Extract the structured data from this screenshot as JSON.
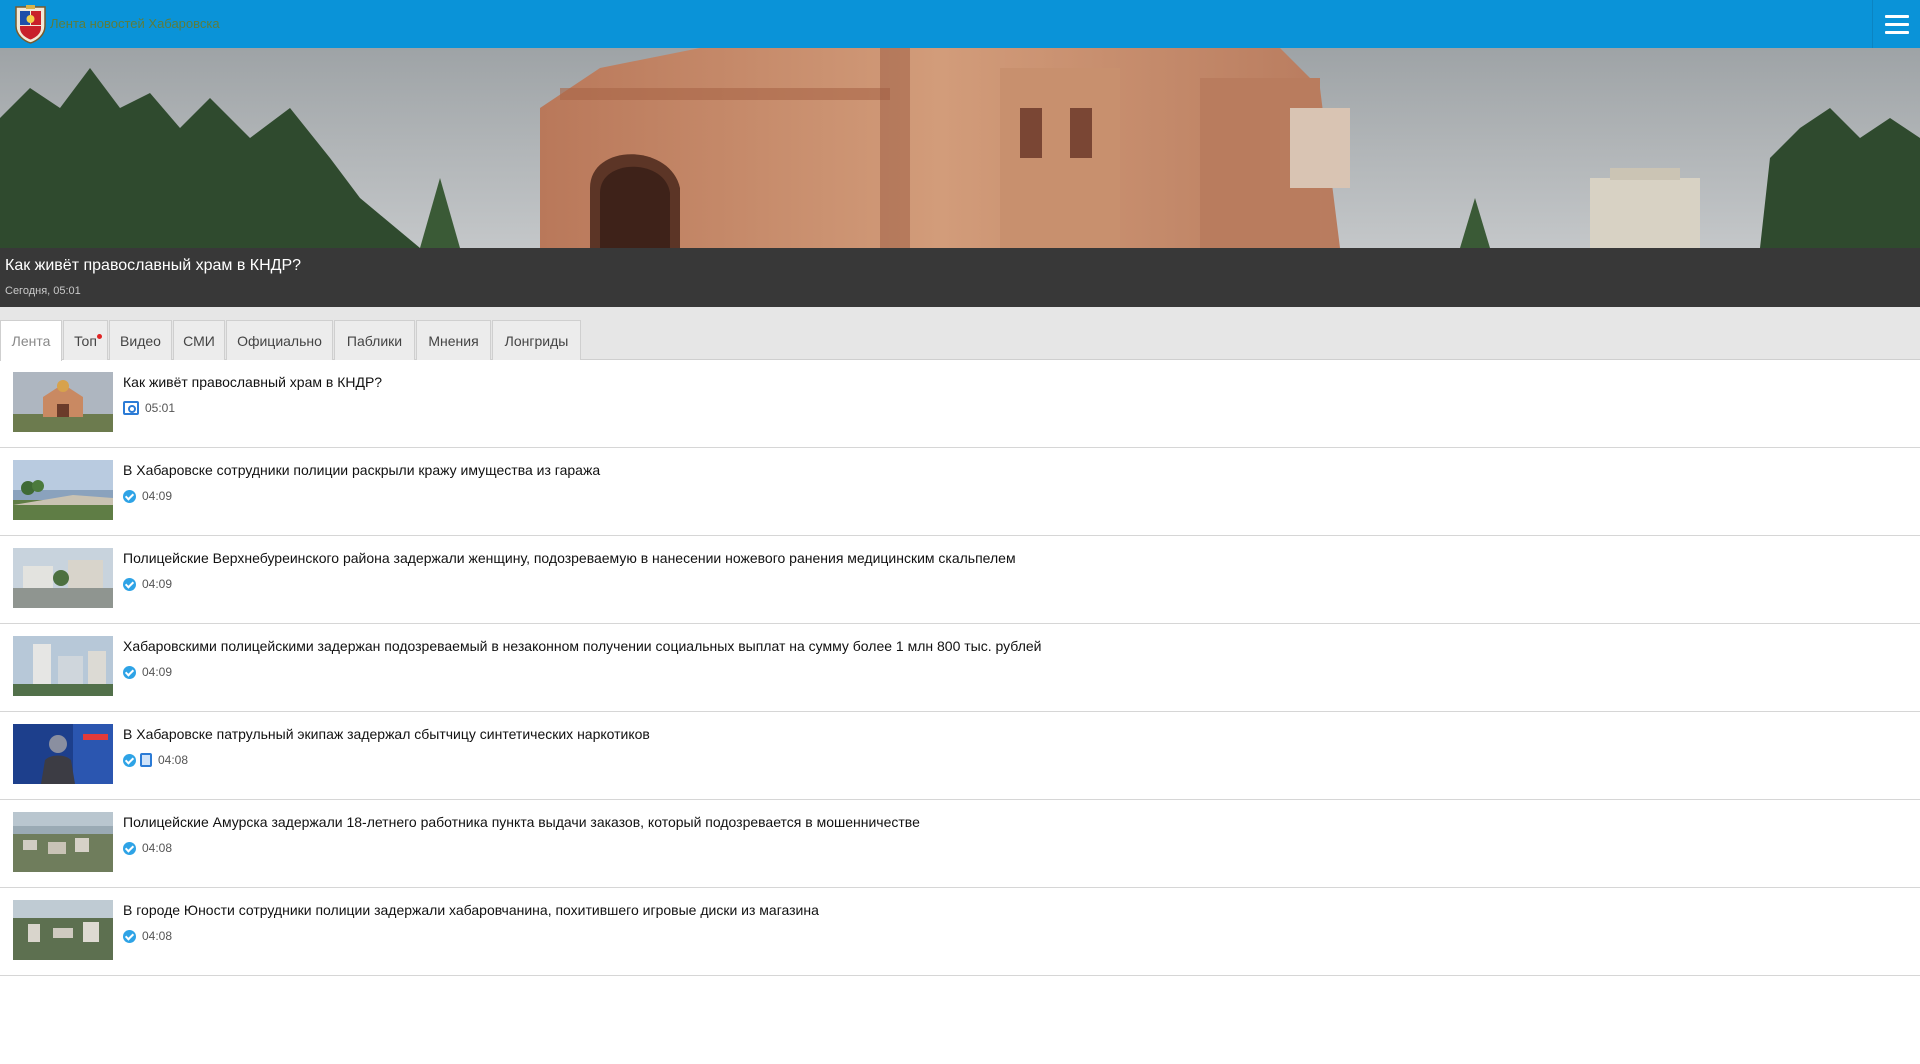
{
  "header": {
    "site_title": "Лента новостей Хабаровска",
    "menu_icon": "hamburger-menu-icon",
    "accent_color": "#0a93d8"
  },
  "hero": {
    "title": "Как живёт православный храм в КНДР?",
    "date": "Сегодня, 05:01"
  },
  "tabs": [
    {
      "label": "Лента",
      "active": true
    },
    {
      "label": "Топ",
      "active": false,
      "badge": "red-dot"
    },
    {
      "label": "Видео",
      "active": false
    },
    {
      "label": "СМИ",
      "active": false
    },
    {
      "label": "Официально",
      "active": false
    },
    {
      "label": "Паблики",
      "active": false
    },
    {
      "label": "Мнения",
      "active": false
    },
    {
      "label": "Лонгриды",
      "active": false
    }
  ],
  "news": [
    {
      "title": "Как живёт православный храм в КНДР?",
      "time": "05:01",
      "icons": [
        "camera-icon"
      ]
    },
    {
      "title": "В Хабаровске сотрудники полиции раскрыли кражу имущества из гаража",
      "time": "04:09",
      "icons": [
        "verified-check-icon"
      ]
    },
    {
      "title": "Полицейские Верхнебуреинского района задержали женщину, подозреваемую в нанесении ножевого ранения медицинским скальпелем",
      "time": "04:09",
      "icons": [
        "verified-check-icon"
      ]
    },
    {
      "title": "Хабаровскими полицейскими задержан подозреваемый в незаконном получении социальных выплат на сумму более 1 млн 800 тыс. рублей",
      "time": "04:09",
      "icons": [
        "verified-check-icon"
      ]
    },
    {
      "title": "В Хабаровске патрульный экипаж задержал сбытчицу синтетических наркотиков",
      "time": "04:08",
      "icons": [
        "verified-check-icon",
        "document-icon"
      ]
    },
    {
      "title": "Полицейские Амурска задержали 18-летнего работника пункта выдачи заказов, который подозревается в мошенничестве",
      "time": "04:08",
      "icons": [
        "verified-check-icon"
      ]
    },
    {
      "title": "В городе Юности сотрудники полиции задержали хабаровчанина, похитившего игровые диски из магазина",
      "time": "04:08",
      "icons": [
        "verified-check-icon"
      ]
    }
  ]
}
